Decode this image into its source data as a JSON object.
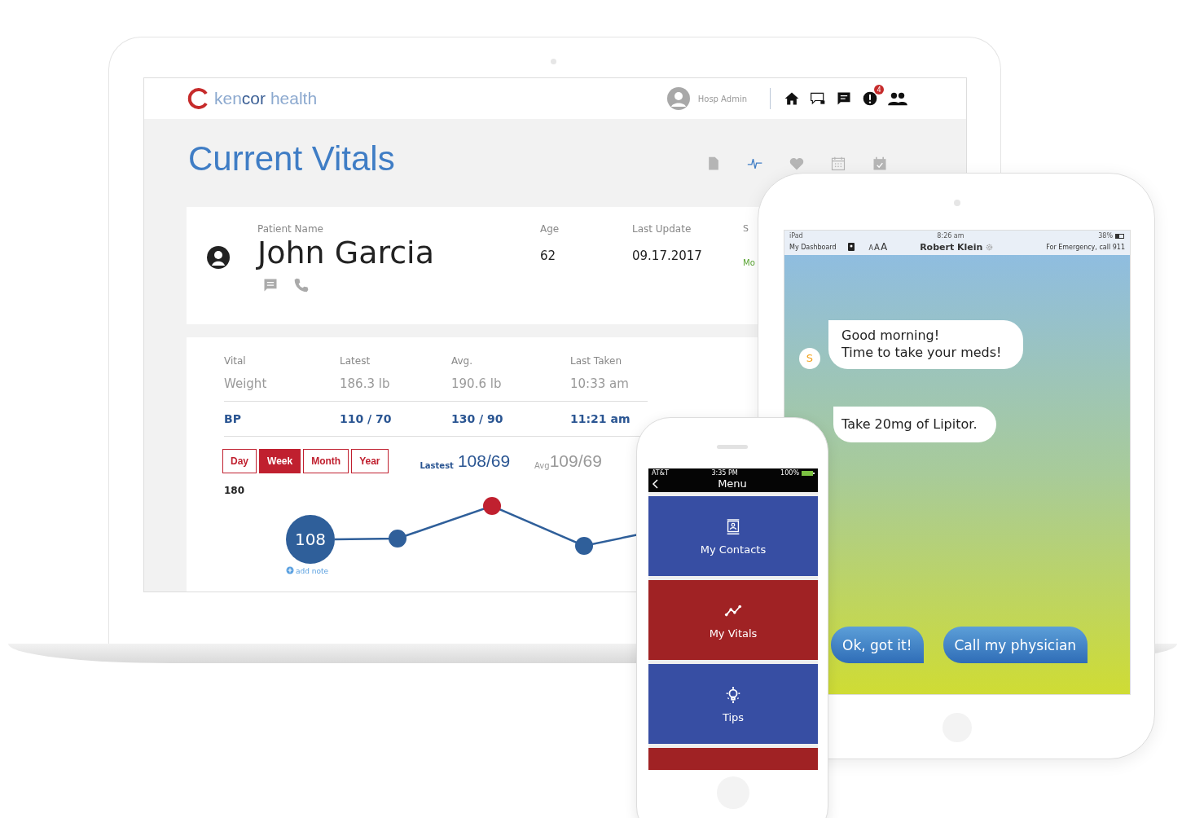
{
  "laptop": {
    "brand": "ken**cor** health",
    "user": "Hosp Admin",
    "alerts_badge": "4",
    "title": "Current Vitals",
    "view_tabs": [
      {
        "selected": false
      },
      {
        "selected": true
      },
      {
        "selected": false
      },
      {
        "selected": false
      },
      {
        "selected": false
      }
    ],
    "patient": {
      "fields": [
        {
          "label": "Patient Name",
          "value": "John Garcia"
        },
        {
          "label": "Age",
          "value": "62"
        },
        {
          "label": "Last Update",
          "value": "09.17.2017"
        },
        {
          "label": "S",
          "value": "Mo"
        }
      ]
    },
    "vitals": {
      "columns": [
        "Vital",
        "Latest",
        "Avg.",
        "Last Taken"
      ],
      "rows": [
        {
          "cells": [
            "Weight",
            "186.3 lb",
            "190.6 lb",
            "10:33 am"
          ],
          "selected": false
        },
        {
          "cells": [
            "BP",
            "110 / 70",
            "130 / 90",
            "11:21 am"
          ],
          "selected": true
        }
      ]
    },
    "periods": [
      {
        "label": "Day",
        "selected": false
      },
      {
        "label": "Week",
        "selected": true
      },
      {
        "label": "Month",
        "selected": false
      },
      {
        "label": "Year",
        "selected": false
      }
    ],
    "latest_label": "Lastest",
    "latest": "108/69",
    "avg_label": "Avg",
    "avg": "109/69",
    "chart": {
      "axis_label": "180",
      "bubble": "108",
      "add_note": "add note"
    }
  },
  "tablet": {
    "status": {
      "device": "iPad",
      "time": "8:26 am",
      "battery": "38%"
    },
    "nav": {
      "dashboard": "My Dashboard",
      "font_sizes": [
        "A",
        "A",
        "A"
      ],
      "title": "Robert Klein",
      "emergency": "For Emergency, call 911"
    },
    "avatar": "S",
    "messages": [
      "Good morning!\nTime to take your meds!",
      "Take 20mg of Lipitor."
    ],
    "replies": [
      "Ok, got it!",
      "Call my physician"
    ]
  },
  "phone": {
    "status": {
      "carrier": "AT&T",
      "time": "3:35 PM",
      "battery": "100%"
    },
    "title": "Menu",
    "tiles": [
      {
        "label": "My Contacts",
        "color": "#374ea3"
      },
      {
        "label": "My Vitals",
        "color": "#a02224"
      },
      {
        "label": "Tips",
        "color": "#374ea3"
      },
      {
        "color": "#a02224"
      }
    ]
  }
}
